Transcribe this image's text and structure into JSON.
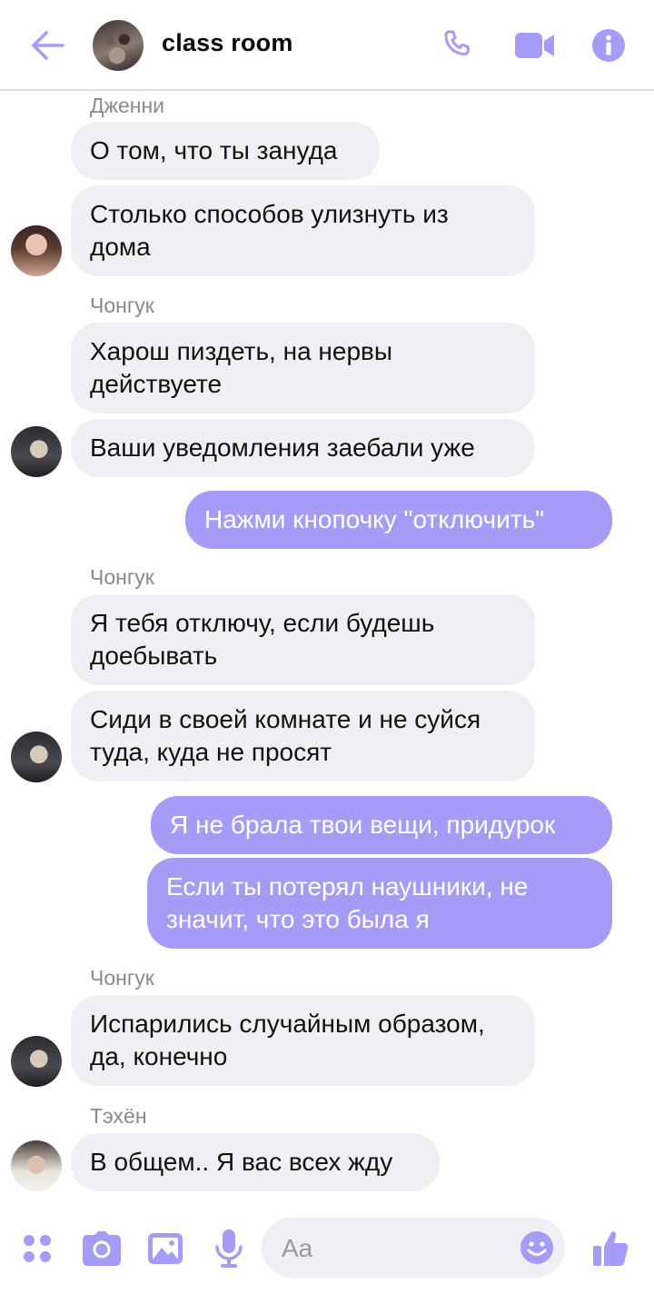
{
  "header": {
    "title": "class room"
  },
  "messages": [
    {
      "sender": "Дженни",
      "text": "О том, что ты зануда"
    },
    {
      "text": "Столько способов улизнуть из дома"
    },
    {
      "sender": "Чонгук",
      "text": "Харош пиздеть, на нервы действуете"
    },
    {
      "text": "Ваши уведомления заебали уже"
    },
    {
      "text": "Нажми кнопочку \"отключить\""
    },
    {
      "sender": "Чонгук",
      "text": "Я тебя отключу, если будешь доебывать"
    },
    {
      "text": "Сиди в своей комнате и не суйся туда, куда не просят"
    },
    {
      "text": "Я не брала твои вещи, придурок"
    },
    {
      "text": "Если ты потерял наушники, не значит, что это была я"
    },
    {
      "sender": "Чонгук",
      "text": "Испарились случайным образом, да, конечно"
    },
    {
      "sender": "Тэхён",
      "text": "В общем.. Я вас всех жду"
    }
  ],
  "composer": {
    "placeholder": "Aa"
  },
  "icons": [
    "back-arrow-icon",
    "phone-icon",
    "video-camera-icon",
    "info-icon",
    "apps-icon",
    "camera-icon",
    "gallery-icon",
    "microphone-icon",
    "emoji-icon",
    "thumbs-up-icon"
  ],
  "colors": {
    "accent": "#a69bf6",
    "incoming_bubble": "#f0eff3",
    "outgoing_bubble": "#a69bf6"
  }
}
